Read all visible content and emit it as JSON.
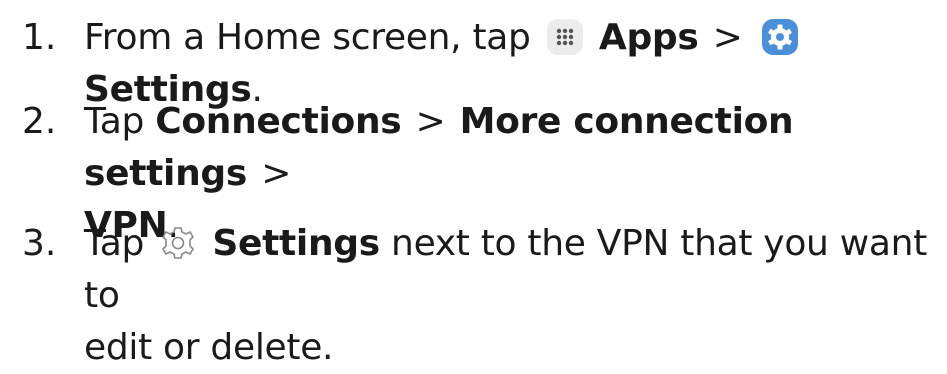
{
  "steps": [
    {
      "number": "1.",
      "prefix": "From a Home screen, tap",
      "apps_icon": "apps-grid-icon",
      "apps": "Apps",
      "sep1": ">",
      "settings_icon": "settings-gear-icon",
      "settings": "Settings",
      "suffix": "."
    },
    {
      "number": "2.",
      "prefix": "Tap",
      "connections": "Connections",
      "sep1": ">",
      "more": "More connection settings",
      "sep2": ">",
      "vpn": "VPN",
      "suffix": "."
    },
    {
      "number": "3.",
      "prefix": "Tap",
      "settings_icon": "settings-outline-icon",
      "settings": "Settings",
      "rest_line1": "next to the VPN that you want to",
      "rest_line2": "edit or delete."
    }
  ],
  "colors": {
    "text": "#1a1a1a",
    "settings_icon_bg": "#4a90d9",
    "apps_icon_bg": "#ececec",
    "outline_icon": "#8a8a8a"
  }
}
